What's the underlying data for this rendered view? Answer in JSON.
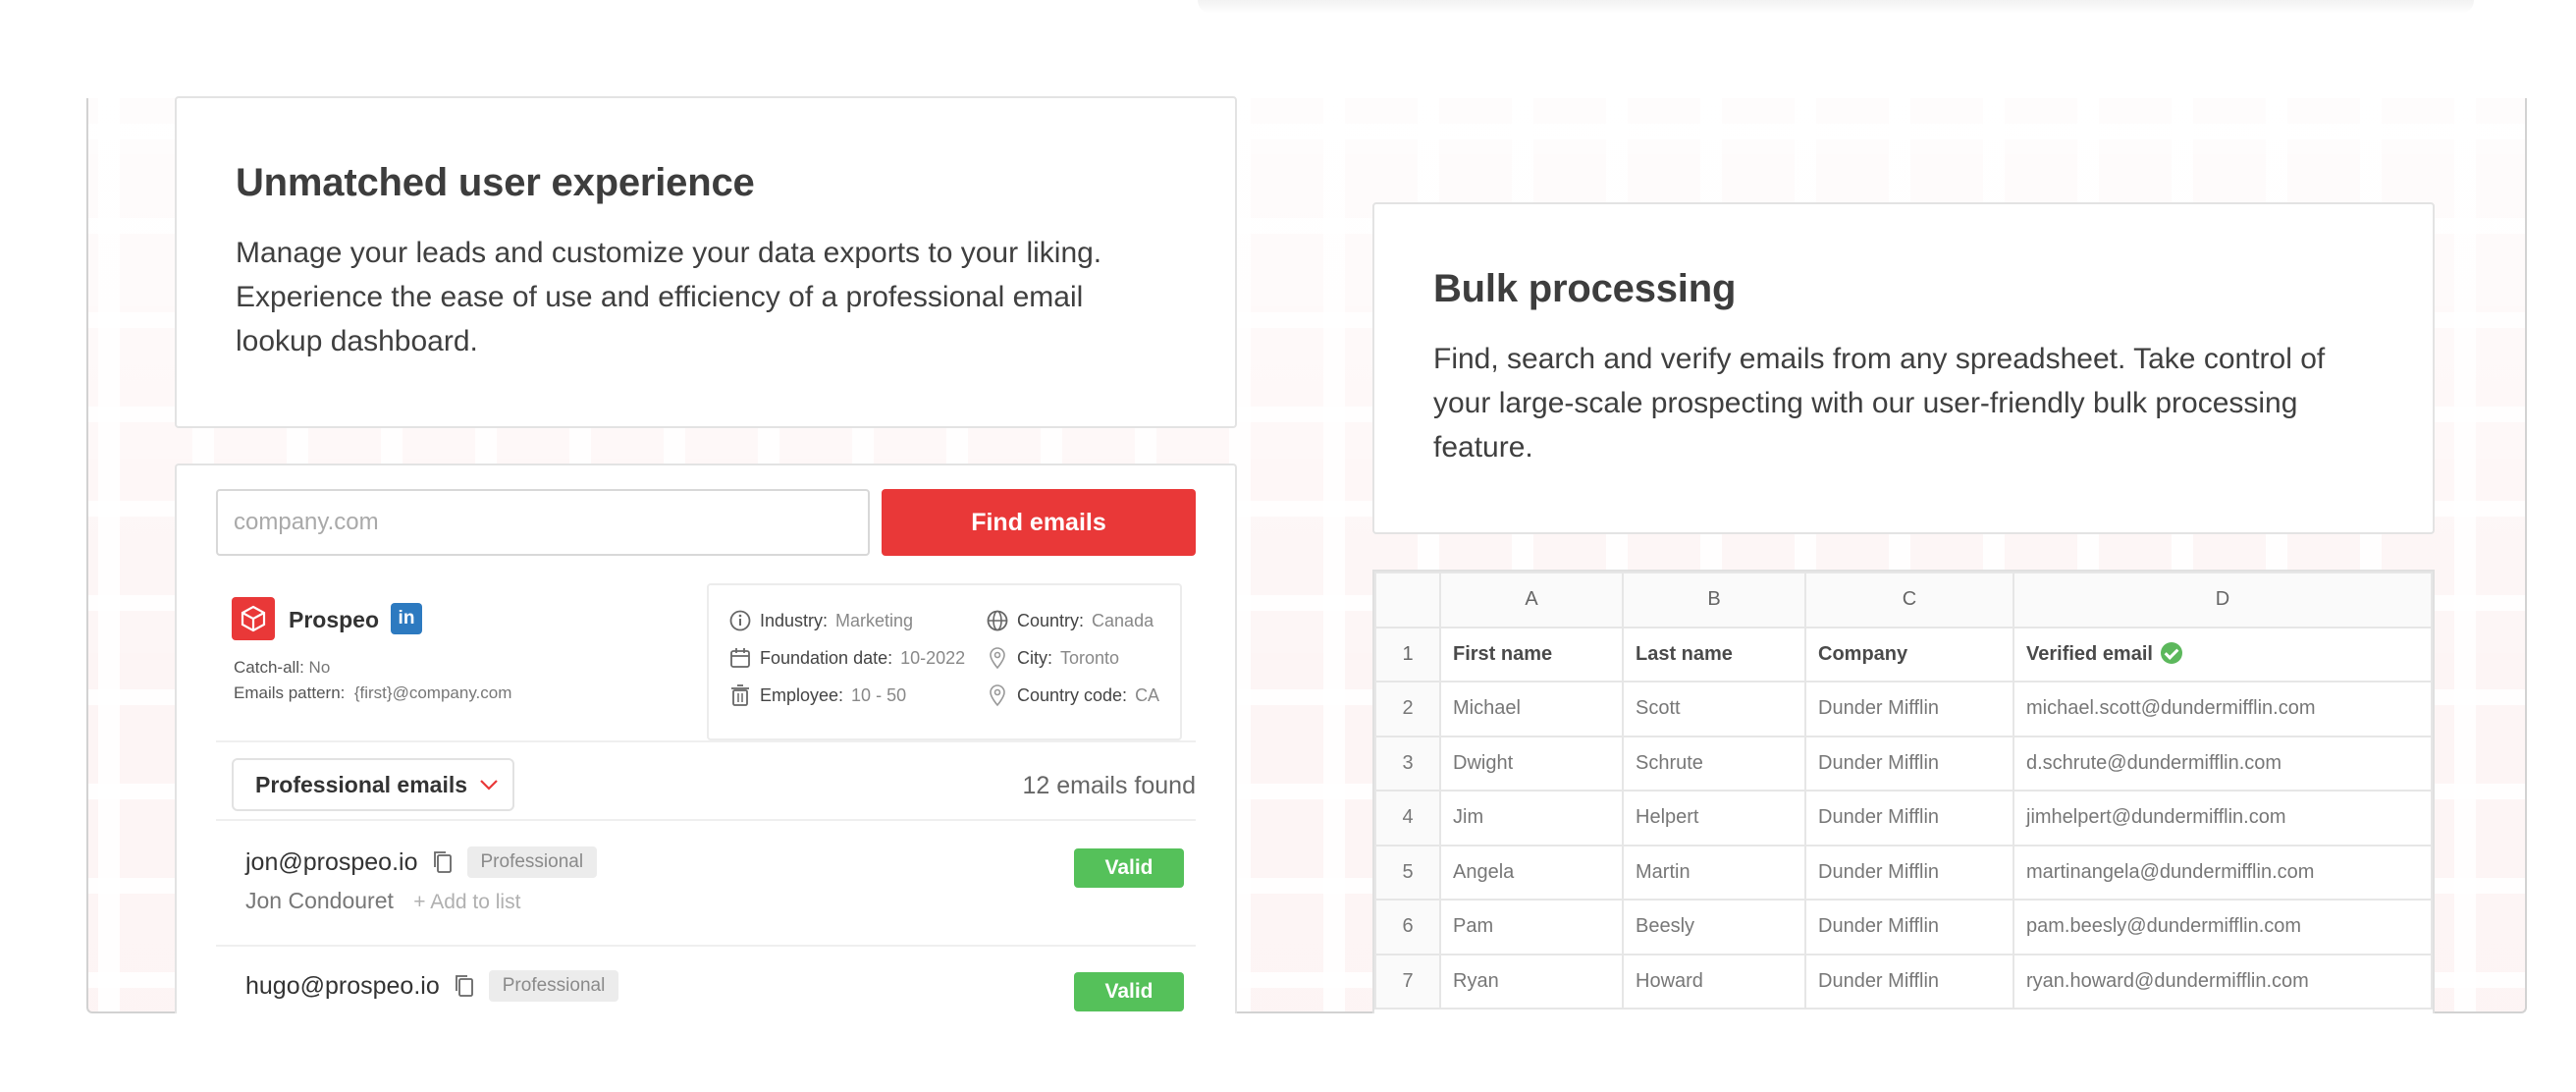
{
  "features": {
    "ux": {
      "title": "Unmatched user experience",
      "body": "Manage your leads and customize your data exports to your liking. Experience the ease of use and efficiency of a professional email lookup dashboard."
    },
    "bulk": {
      "title": "Bulk processing",
      "body": "Find, search and verify emails from any spreadsheet. Take control of your large-scale prospecting with our user-friendly bulk processing feature."
    }
  },
  "dashboard": {
    "search_placeholder": "company.com",
    "find_button": "Find emails",
    "company": {
      "name": "Prospeo",
      "linkedin": "in",
      "catch_all_label": "Catch-all:",
      "catch_all_value": "No",
      "pattern_label": "Emails pattern:",
      "pattern_value": "{first}@company.com"
    },
    "info": {
      "industry_label": "Industry:",
      "industry_value": "Marketing",
      "country_label": "Country:",
      "country_value": "Canada",
      "foundation_label": "Foundation date:",
      "foundation_value": "10-2022",
      "city_label": "City:",
      "city_value": "Toronto",
      "employee_label": "Employee:",
      "employee_value": "10 - 50",
      "country_code_label": "Country code:",
      "country_code_value": "CA"
    },
    "filter_label": "Professional emails",
    "found_text": "12 emails found",
    "emails": [
      {
        "email": "jon@prospeo.io",
        "tag": "Professional",
        "status": "Valid",
        "name": "Jon Condouret",
        "add": "+ Add to list"
      },
      {
        "email": "hugo@prospeo.io",
        "tag": "Professional",
        "status": "Valid"
      }
    ]
  },
  "sheet": {
    "columns": [
      "A",
      "B",
      "C",
      "D"
    ],
    "rows": [
      {
        "n": "1",
        "cells": [
          "First name",
          "Last name",
          "Company",
          "Verified email"
        ]
      },
      {
        "n": "2",
        "cells": [
          "Michael",
          "Scott",
          "Dunder Mifflin",
          "michael.scott@dundermifflin.com"
        ]
      },
      {
        "n": "3",
        "cells": [
          "Dwight",
          "Schrute",
          "Dunder Mifflin",
          "d.schrute@dundermifflin.com"
        ]
      },
      {
        "n": "4",
        "cells": [
          "Jim",
          "Helpert",
          "Dunder Mifflin",
          "jimhelpert@dundermifflin.com"
        ]
      },
      {
        "n": "5",
        "cells": [
          "Angela",
          "Martin",
          "Dunder Mifflin",
          "martinangela@dundermifflin.com"
        ]
      },
      {
        "n": "6",
        "cells": [
          "Pam",
          "Beesly",
          "Dunder Mifflin",
          "pam.beesly@dundermifflin.com"
        ]
      },
      {
        "n": "7",
        "cells": [
          "Ryan",
          "Howard",
          "Dunder Mifflin",
          "ryan.howard@dundermifflin.com"
        ]
      }
    ]
  },
  "colors": {
    "brand_red": "#e93838",
    "valid_green": "#55c15a",
    "linkedin_blue": "#2d7ac0"
  }
}
